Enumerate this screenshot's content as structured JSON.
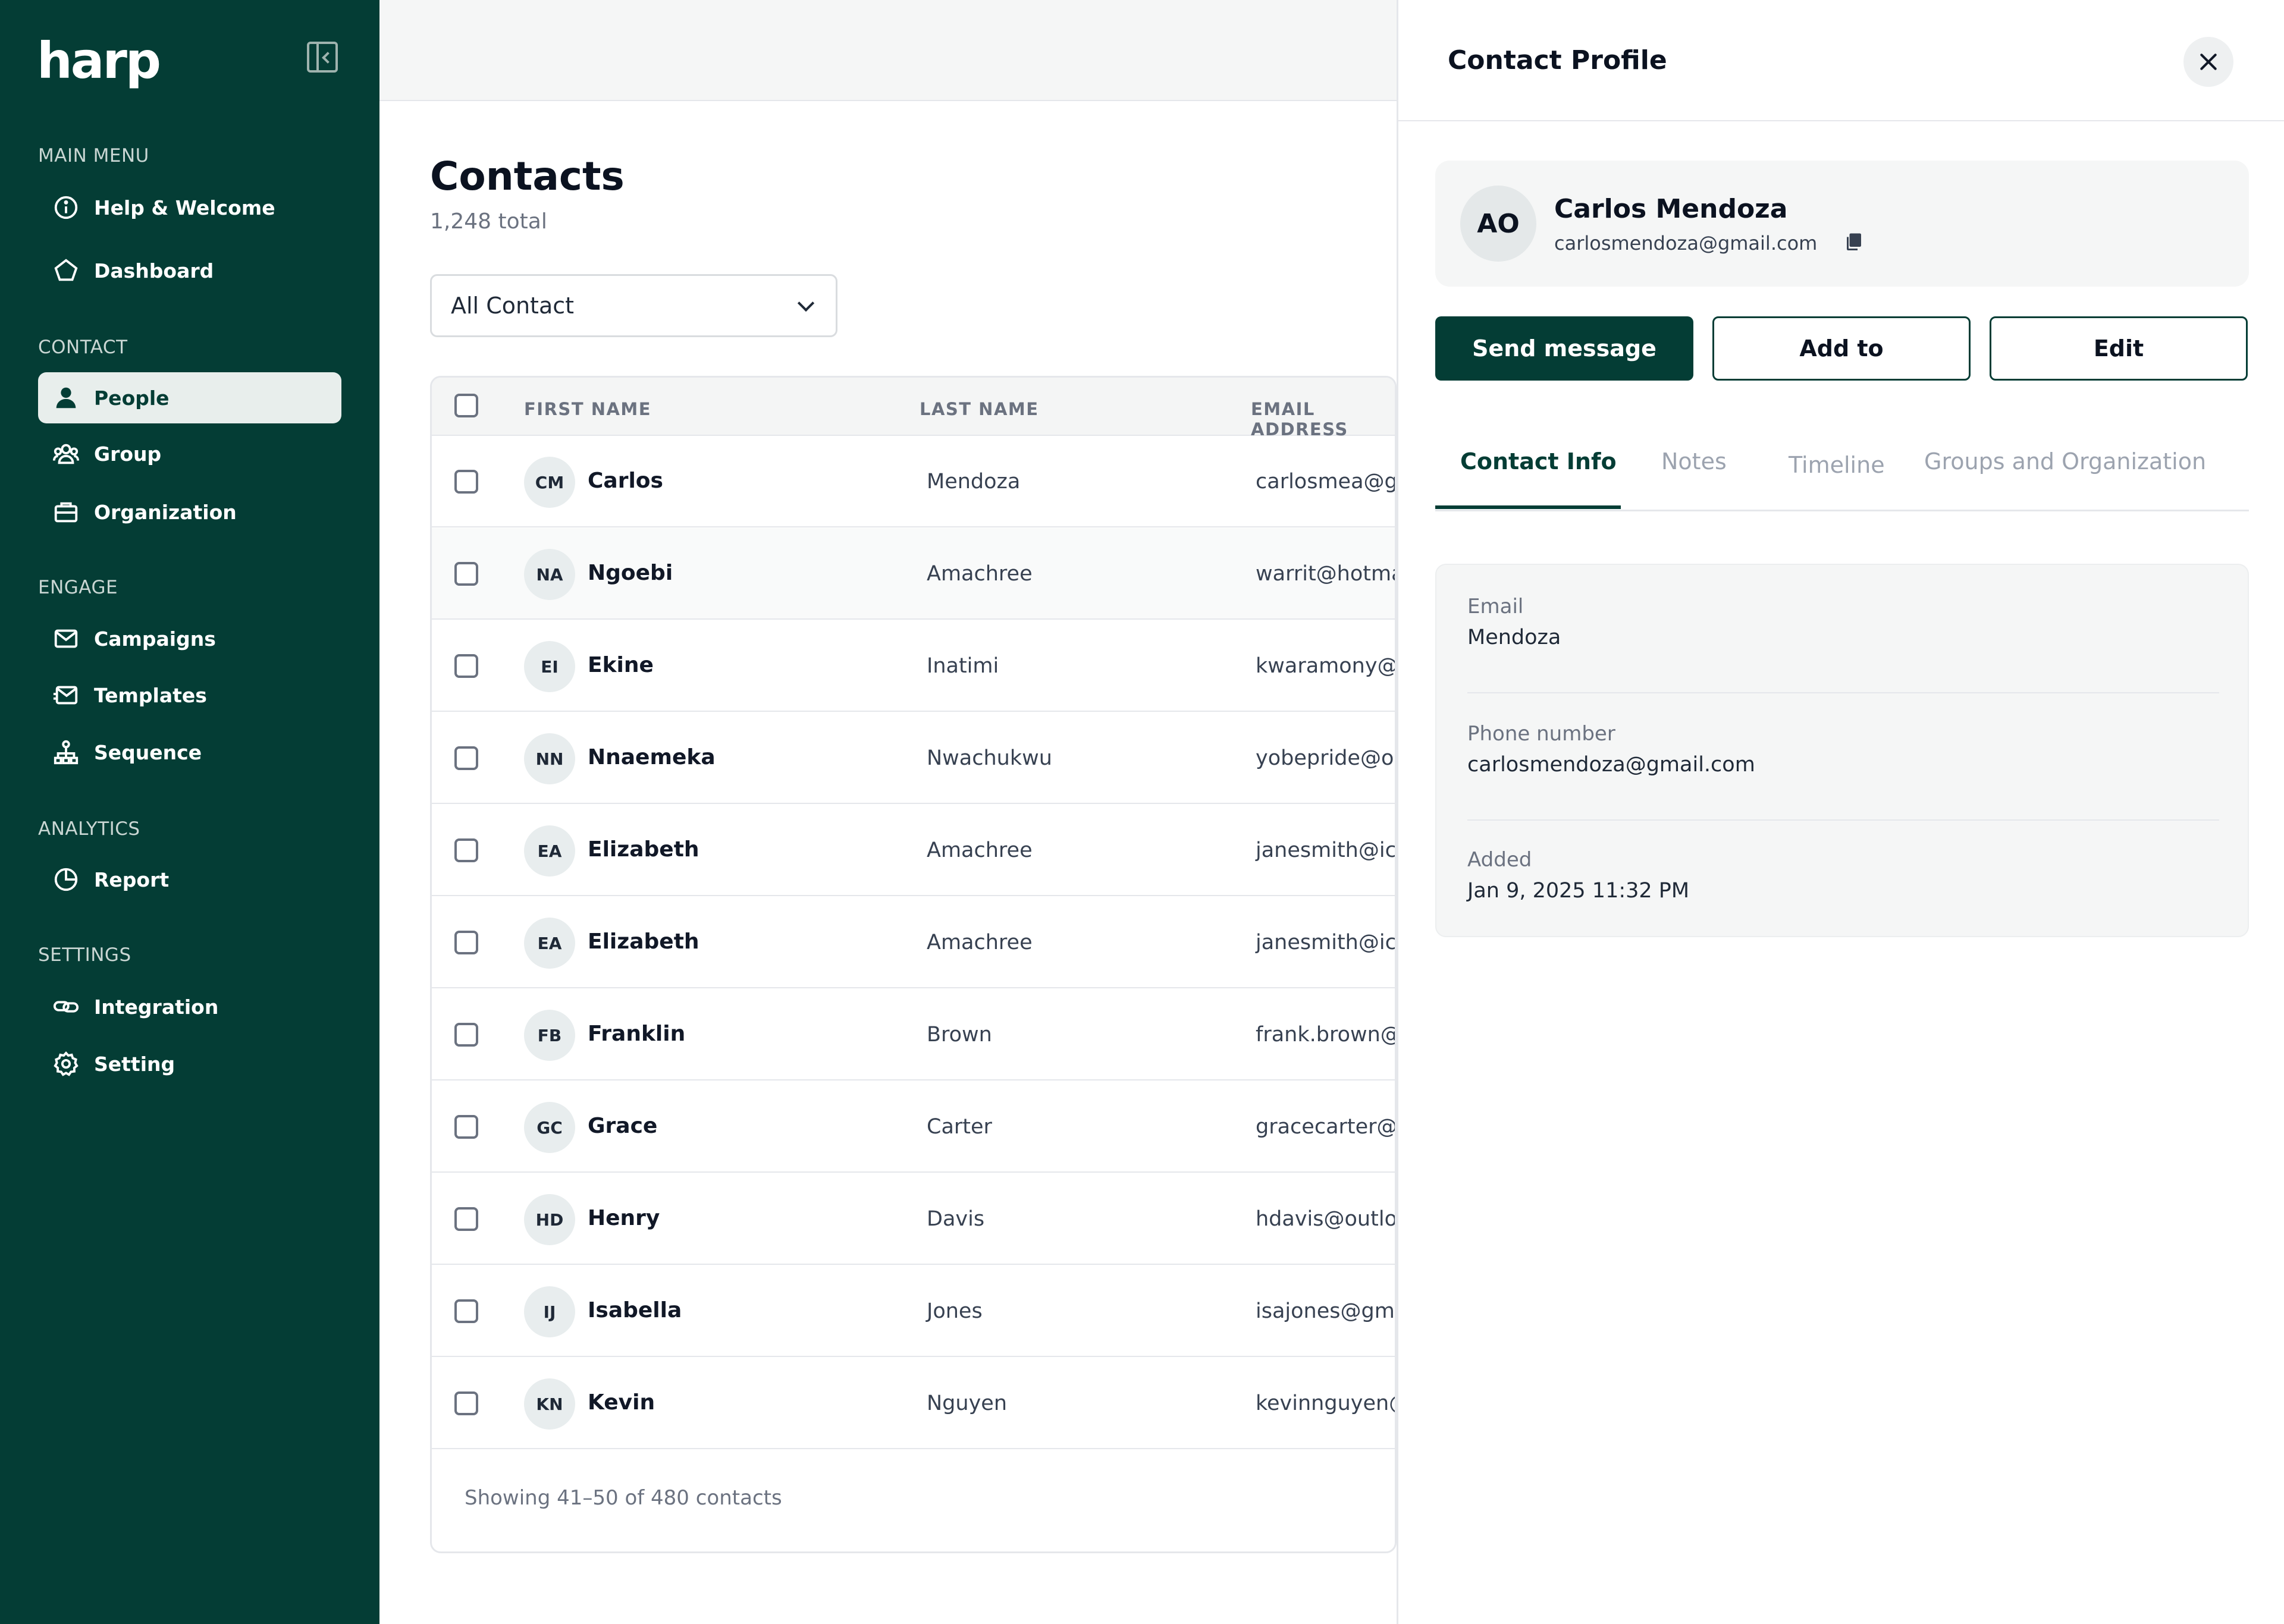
{
  "app": {
    "logo": "harp"
  },
  "sidebar": {
    "sections": {
      "main_menu": "MAIN MENU",
      "contact": "CONTACT",
      "engage": "ENGAGE",
      "analytics": "ANALYTICS",
      "settings": "SETTINGS"
    },
    "items": {
      "help": "Help & Welcome",
      "dashboard": "Dashboard",
      "people": "People",
      "group": "Group",
      "organization": "Organization",
      "campaigns": "Campaigns",
      "templates": "Templates",
      "sequence": "Sequence",
      "report": "Report",
      "integration": "Integration",
      "setting": "Setting"
    },
    "active_item": "People"
  },
  "main": {
    "title": "Contacts",
    "subtitle": "1,248 total",
    "filter": {
      "selected": "All Contact"
    },
    "table": {
      "headers": {
        "first": "FIRST NAME",
        "last": "LAST NAME",
        "email": "EMAIL ADDRESS"
      },
      "rows": [
        {
          "initials": "CM",
          "first": "Carlos",
          "last": "Mendoza",
          "email": "carlosmea@gm"
        },
        {
          "initials": "NA",
          "first": "Ngoebi",
          "last": "Amachree",
          "email": "warrit@hotmai"
        },
        {
          "initials": "EI",
          "first": "Ekine",
          "last": "Inatimi",
          "email": "kwaramony@y"
        },
        {
          "initials": "NN",
          "first": "Nnaemeka",
          "last": "Nwachukwu",
          "email": "yobepride@ou"
        },
        {
          "initials": "EA",
          "first": "Elizabeth",
          "last": "Amachree",
          "email": "janesmith@iclo"
        },
        {
          "initials": "EA",
          "first": "Elizabeth",
          "last": "Amachree",
          "email": "janesmith@iclo"
        },
        {
          "initials": "FB",
          "first": "Franklin",
          "last": "Brown",
          "email": "frank.brown@m"
        },
        {
          "initials": "GC",
          "first": "Grace",
          "last": "Carter",
          "email": "gracecarter@y"
        },
        {
          "initials": "HD",
          "first": "Henry",
          "last": "Davis",
          "email": "hdavis@outloo"
        },
        {
          "initials": "IJ",
          "first": "Isabella",
          "last": "Jones",
          "email": "isajones@gma"
        },
        {
          "initials": "KN",
          "first": "Kevin",
          "last": "Nguyen",
          "email": "kevinnguyen@"
        }
      ],
      "footer": "Showing 41–50 of 480 contacts"
    }
  },
  "panel": {
    "title": "Contact Profile",
    "profile": {
      "initials": "AO",
      "name": "Carlos Mendoza",
      "email": "carlosmendoza@gmail.com"
    },
    "buttons": {
      "send": "Send message",
      "add": "Add to",
      "edit": "Edit"
    },
    "tabs": {
      "info": "Contact Info",
      "notes": "Notes",
      "timeline": "Timeline",
      "groups": "Groups and Organization"
    },
    "info": {
      "email_label": "Email",
      "email_value": "Mendoza",
      "phone_label": "Phone number",
      "phone_value": "carlosmendoza@gmail.com",
      "added_label": "Added",
      "added_value": "Jan 9, 2025 11:32 PM"
    }
  },
  "colors": {
    "brand": "#043d35",
    "active_bg": "#e8eeec"
  }
}
